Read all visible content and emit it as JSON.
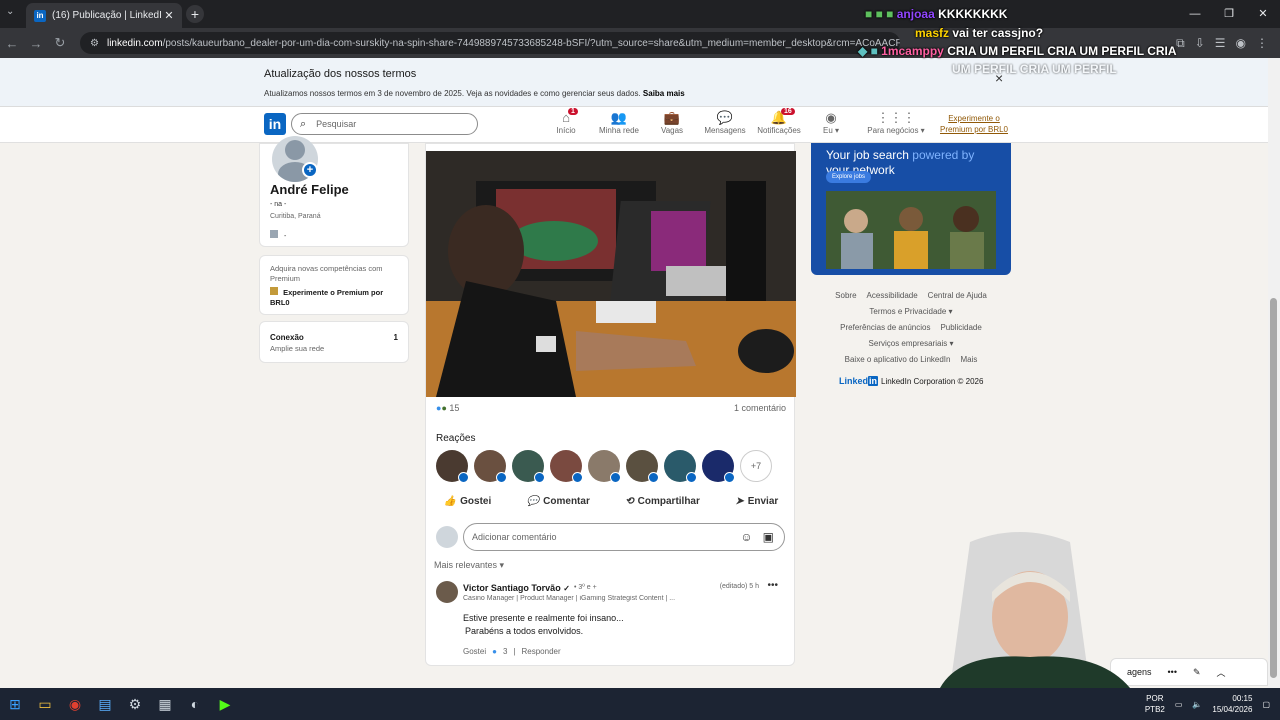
{
  "browser": {
    "tab_title": "(16) Publicação | LinkedIn",
    "tab_favicon": "in",
    "url_host": "linkedin.com",
    "url_path": "/posts/kaueurbano_dealer-por-um-dia-com-surskity-na-spin-share-7449889745733685248-bSFI/?utm_source=share&utm_medium=member_desktop&rcm=ACoAACFr-C8BYn24iTL..."
  },
  "chat_overlay": [
    {
      "user": "anjoaa",
      "message": "KKKKKKKK",
      "user_color": "#9146ff"
    },
    {
      "user": "masfz",
      "message": "vai ter cassjno?",
      "user_color": "#ffd400"
    },
    {
      "user": "1mcamppy",
      "message": "CRIA UM PERFIL CRIA UM PERFIL CRIA",
      "user_color": "#ff5fa2"
    },
    {
      "message_cont": "UM PERFIL CRIA UM PERFIL"
    }
  ],
  "banner": {
    "title": "Atualização dos nossos termos",
    "desc": "Atualizamos nossos termos em 3 de novembro de 2025. Veja as novidades e como gerenciar seus dados.",
    "link": "Saiba mais",
    "close": "×"
  },
  "nav": {
    "search_placeholder": "Pesquisar",
    "items": [
      {
        "label": "Início",
        "icon": "home-icon",
        "badge": "1"
      },
      {
        "label": "Minha rede",
        "icon": "network-icon"
      },
      {
        "label": "Vagas",
        "icon": "briefcase-icon"
      },
      {
        "label": "Mensagens",
        "icon": "chat-icon"
      },
      {
        "label": "Notificações",
        "icon": "bell-icon",
        "badge": "16"
      },
      {
        "label": "Eu ▾",
        "icon": "avatar-icon"
      },
      {
        "label": "Para negócios ▾",
        "icon": "grid-icon"
      }
    ],
    "premium": "Experimente o Premium por BRL0"
  },
  "profile": {
    "name": "André Felipe",
    "headline": "- na -",
    "location": "Curitiba, Paraná",
    "company": "-"
  },
  "premium_card": {
    "text": "Adquira novas competências com Premium",
    "cta": "Experimente o Premium por BRL0"
  },
  "connections": {
    "label": "Conexão",
    "count": "1",
    "sub": "Amplie sua rede"
  },
  "post": {
    "reaction_count": "15",
    "comment_count": "1 comentário",
    "reactions_title": "Reações",
    "more_reactors": "+7",
    "actions": [
      "Gostei",
      "Comentar",
      "Compartilhar",
      "Enviar"
    ],
    "comment_placeholder": "Adicionar comentário",
    "sort": "Mais relevantes ▾"
  },
  "comment": {
    "author": "Victor Santiago Torvão",
    "degree": "• 3º e +",
    "edited": "(editado) 5 h",
    "role": "Casino Manager | Product Manager | iGaming Strategist Content | ...",
    "line1": "Estive presente e realmente foi insano...",
    "line2": "Parabéns a todos envolvidos.",
    "like": "Gostei",
    "like_count": "3",
    "reply": "Responder"
  },
  "ad": {
    "headline_a": "Your job search",
    "headline_b": "powered by",
    "headline_c": "your network",
    "cta": "Explore jobs"
  },
  "footer": {
    "links": [
      "Sobre",
      "Acessibilidade",
      "Central de Ajuda",
      "Termos e Privacidade ▾",
      "Preferências de anúncios",
      "Publicidade",
      "Serviços empresariais ▾",
      "Baixe o aplicativo do LinkedIn",
      "Mais"
    ],
    "brand": "Linked",
    "brand_in": "in",
    "copyright": "LinkedIn Corporation © 2026"
  },
  "msgbar": {
    "label": "agens"
  },
  "taskbar": {
    "lang": "POR",
    "lang2": "PTB2",
    "time": "00:15",
    "date": "15/04/2026"
  }
}
